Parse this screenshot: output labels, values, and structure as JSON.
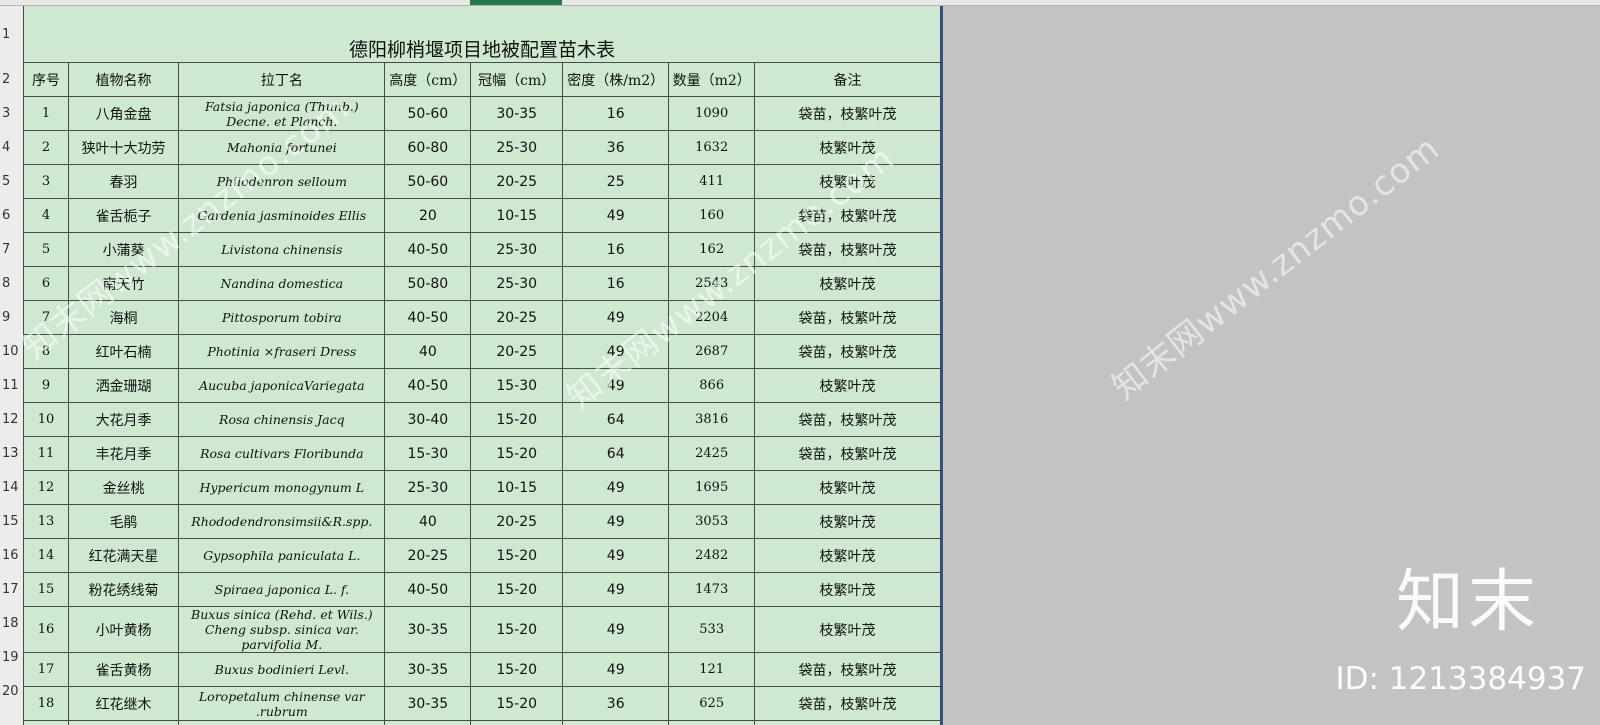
{
  "sheet": {
    "title": "德阳柳梢堰项目地被配置苗木表",
    "row_numbers": [
      "1",
      "2",
      "3",
      "4",
      "5",
      "6",
      "7",
      "8",
      "9",
      "10",
      "11",
      "12",
      "13",
      "14",
      "15",
      "16",
      "17",
      "18",
      "19",
      "20"
    ],
    "headers": [
      "序号",
      "植物名称",
      "拉丁名",
      "高度（cm）",
      "冠幅（cm）",
      "密度（株/m2）",
      "数量（m2）",
      "备注"
    ],
    "rows": [
      {
        "no": "1",
        "name": "八角金盘",
        "latin": "Fatsia japonica (Thunb.) Decne. et Planch.",
        "height": "50-60",
        "crown": "30-35",
        "density": "16",
        "qty": "1090",
        "note": "袋苗，枝繁叶茂"
      },
      {
        "no": "2",
        "name": "狭叶十大功劳",
        "latin": "Mahonia fortunei",
        "height": "60-80",
        "crown": "25-30",
        "density": "36",
        "qty": "1632",
        "note": "枝繁叶茂"
      },
      {
        "no": "3",
        "name": "春羽",
        "latin": "Philodenron selloum",
        "height": "50-60",
        "crown": "20-25",
        "density": "25",
        "qty": "411",
        "note": "枝繁叶茂"
      },
      {
        "no": "4",
        "name": "雀舌栀子",
        "latin": "Gardenia jasminoides Ellis",
        "height": "20",
        "crown": "10-15",
        "density": "49",
        "qty": "160",
        "note": "袋苗，枝繁叶茂"
      },
      {
        "no": "5",
        "name": "小蒲葵",
        "latin": "Livistona chinensis",
        "height": "40-50",
        "crown": "25-30",
        "density": "16",
        "qty": "162",
        "note": "袋苗，枝繁叶茂"
      },
      {
        "no": "6",
        "name": "南天竹",
        "latin": "Nandina domestica",
        "height": "50-80",
        "crown": "25-30",
        "density": "16",
        "qty": "2543",
        "note": "枝繁叶茂"
      },
      {
        "no": "7",
        "name": "海桐",
        "latin": "Pittosporum tobira",
        "height": "40-50",
        "crown": "20-25",
        "density": "49",
        "qty": "2204",
        "note": "袋苗，枝繁叶茂"
      },
      {
        "no": "8",
        "name": "红叶石楠",
        "latin": "Photinia ×fraseri Dress",
        "height": "40",
        "crown": "20-25",
        "density": "49",
        "qty": "2687",
        "note": "袋苗，枝繁叶茂"
      },
      {
        "no": "9",
        "name": "洒金珊瑚",
        "latin": "Aucuba japonicaVariegata",
        "height": "40-50",
        "crown": "15-30",
        "density": "49",
        "qty": "866",
        "note": "枝繁叶茂"
      },
      {
        "no": "10",
        "name": "大花月季",
        "latin": "Rosa chinensis Jacq",
        "height": "30-40",
        "crown": "15-20",
        "density": "64",
        "qty": "3816",
        "note": "袋苗，枝繁叶茂"
      },
      {
        "no": "11",
        "name": "丰花月季",
        "latin": "Rosa cultivars Floribunda",
        "height": "15-30",
        "crown": "15-20",
        "density": "64",
        "qty": "2425",
        "note": "袋苗，枝繁叶茂"
      },
      {
        "no": "12",
        "name": "金丝桃",
        "latin": "Hypericum monogynum L",
        "height": "25-30",
        "crown": "10-15",
        "density": "49",
        "qty": "1695",
        "note": "枝繁叶茂"
      },
      {
        "no": "13",
        "name": "毛鹃",
        "latin": "Rhododendronsimsii&R.spp.",
        "height": "40",
        "crown": "20-25",
        "density": "49",
        "qty": "3053",
        "note": "枝繁叶茂"
      },
      {
        "no": "14",
        "name": "红花满天星",
        "latin": "Gypsophila paniculata L.",
        "height": "20-25",
        "crown": "15-20",
        "density": "49",
        "qty": "2482",
        "note": "枝繁叶茂"
      },
      {
        "no": "15",
        "name": "粉花绣线菊",
        "latin": "Spiraea japonica L. f.",
        "height": "40-50",
        "crown": "15-20",
        "density": "49",
        "qty": "1473",
        "note": "枝繁叶茂"
      },
      {
        "no": "16",
        "name": "小叶黄杨",
        "latin": "Buxus sinica (Rehd. et Wils.) Cheng subsp. sinica var. parvifolia M.",
        "height": "30-35",
        "crown": "15-20",
        "density": "49",
        "qty": "533",
        "note": "枝繁叶茂"
      },
      {
        "no": "17",
        "name": "雀舌黄杨",
        "latin": "Buxus bodinieri Levl.",
        "height": "30-35",
        "crown": "15-20",
        "density": "49",
        "qty": "121",
        "note": "袋苗，枝繁叶茂"
      },
      {
        "no": "18",
        "name": "红花继木",
        "latin": "Loropetalum chinense var .rubrum",
        "height": "30-35",
        "crown": "15-20",
        "density": "36",
        "qty": "625",
        "note": "袋苗，枝繁叶茂"
      }
    ]
  },
  "watermark": {
    "text": "知末网www.znzmo.com",
    "logo": "知末",
    "id": "ID: 1213384937"
  },
  "colors": {
    "sheet_fill": "#cfe9d1",
    "background": "#c3c3c3",
    "selection": "#1f7a4a"
  }
}
